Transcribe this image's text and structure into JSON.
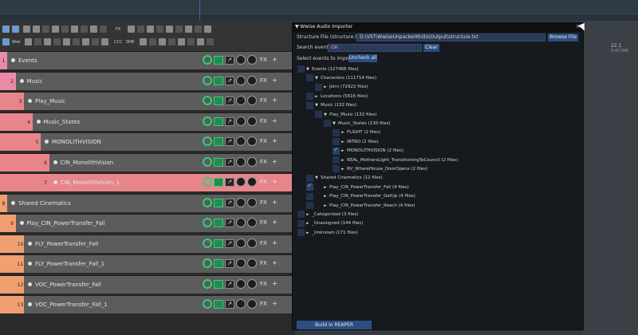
{
  "toolbar_labels": {
    "fx": "FX",
    "wwi": "Wwi",
    "ccc": "CCC",
    "shr": "SHR"
  },
  "tracks": [
    {
      "num": "1",
      "name": "Events",
      "depth": 0,
      "color": "#e88aa8",
      "selected": false
    },
    {
      "num": "2",
      "name": "Music",
      "depth": 1,
      "color": "#e88aa8",
      "selected": false
    },
    {
      "num": "3",
      "name": "Play_Music",
      "depth": 2,
      "color": "#e8858a",
      "selected": false
    },
    {
      "num": "4",
      "name": "Music_States",
      "depth": 3,
      "color": "#e8858a",
      "selected": false
    },
    {
      "num": "5",
      "name": "MONOLITHVISION",
      "depth": 4,
      "color": "#e8858a",
      "selected": false
    },
    {
      "num": "6",
      "name": "CIN_MonolithVision",
      "depth": 5,
      "color": "#e8858a",
      "selected": false
    },
    {
      "num": "7",
      "name": "CIN_MonolithVision_1",
      "depth": 5,
      "color": "#e8858a",
      "selected": true
    },
    {
      "num": "8",
      "name": "Shared Cinematics",
      "depth": 0,
      "color": "#f0a070",
      "selected": false
    },
    {
      "num": "9",
      "name": "Play_CIN_PowerTransfer_Fall",
      "depth": 1,
      "color": "#f0a070",
      "selected": false
    },
    {
      "num": "10",
      "name": "FLY_PowerTransfer_Fall",
      "depth": 2,
      "color": "#f0a070",
      "selected": false
    },
    {
      "num": "11",
      "name": "FLY_PowerTransfer_Fall_1",
      "depth": 2,
      "color": "#f0a070",
      "selected": false
    },
    {
      "num": "12",
      "name": "VOC_PowerTransfer_Fall",
      "depth": 2,
      "color": "#f0a070",
      "selected": false
    },
    {
      "num": "13",
      "name": "VOC_PowerTransfer_Fall_1",
      "depth": 2,
      "color": "#f0a070",
      "selected": false
    }
  ],
  "track_controls": {
    "fx": "FX",
    "plus": "+",
    "env": "↗"
  },
  "dialog": {
    "title": "Wwise Audio Importer",
    "collapse_glyph": "▼",
    "close_glyph": "×",
    "structure_label": "Structure File (structure.txt)",
    "structure_value": "D:\\VST\\WwiseUnpackerKhillo\\Output\\structure.txt",
    "browse_label": "Browse File",
    "search_label": "Search event:",
    "search_value": "cin",
    "clear_label": "Clear",
    "select_label": "Select events to import:",
    "uncheck_label": "Uncheck all",
    "build_label": "Build in REAPER",
    "tree": [
      {
        "label": "Events (127468 files)",
        "depth": 0,
        "arrow": "▼",
        "checked": false,
        "cb_depth": 0
      },
      {
        "label": "Characters (111714 files)",
        "depth": 1,
        "arrow": "▼",
        "checked": false,
        "cb_depth": 1
      },
      {
        "label": "John (72922 files)",
        "depth": 2,
        "arrow": "►",
        "checked": false,
        "cb_depth": 2
      },
      {
        "label": "Locations (5616 files)",
        "depth": 1,
        "arrow": "►",
        "checked": false,
        "cb_depth": 1
      },
      {
        "label": "Music (132 files)",
        "depth": 1,
        "arrow": "▼",
        "checked": false,
        "cb_depth": 1
      },
      {
        "label": "Play_Music (132 files)",
        "depth": 2,
        "arrow": "▼",
        "checked": false,
        "cb_depth": 2
      },
      {
        "label": "Music_States (130 files)",
        "depth": 3,
        "arrow": "▼",
        "checked": false,
        "cb_depth": 3
      },
      {
        "label": "FLIGHT (2 files)",
        "depth": 4,
        "arrow": "►",
        "checked": false,
        "cb_depth": 4
      },
      {
        "label": "INTRO (2 files)",
        "depth": 4,
        "arrow": "►",
        "checked": false,
        "cb_depth": 4
      },
      {
        "label": "MONOLITHVISION (2 files)",
        "depth": 4,
        "arrow": "►",
        "checked": true,
        "cb_depth": 4
      },
      {
        "label": "REAL_MothersLight_TransitioningToCouncil (2 files)",
        "depth": 4,
        "arrow": "►",
        "checked": false,
        "cb_depth": 4
      },
      {
        "label": "RV_WhareHouse_DoorOpens (2 files)",
        "depth": 4,
        "arrow": "►",
        "checked": false,
        "cb_depth": 4
      },
      {
        "label": "Shared Cinematics (12 files)",
        "depth": 1,
        "arrow": "▼",
        "checked": false,
        "cb_depth": 1
      },
      {
        "label": "Play_CIN_PowerTransfer_Fall (4 files)",
        "depth": 2,
        "arrow": "►",
        "checked": true,
        "cb_depth": 1
      },
      {
        "label": "Play_CIN_PowerTransfer_GetUp (4 files)",
        "depth": 2,
        "arrow": "►",
        "checked": false,
        "cb_depth": 1
      },
      {
        "label": "Play_CIN_PowerTransfer_Reach (4 files)",
        "depth": 2,
        "arrow": "►",
        "checked": false,
        "cb_depth": 1
      },
      {
        "label": "_Categorized (3 files)",
        "depth": 0,
        "arrow": "►",
        "checked": false,
        "cb_depth": 0
      },
      {
        "label": "_Unassigned (144 files)",
        "depth": 0,
        "arrow": "►",
        "checked": false,
        "cb_depth": 0
      },
      {
        "label": "_Unknown (171 files)",
        "depth": 0,
        "arrow": "►",
        "checked": false,
        "cb_depth": 0
      }
    ]
  },
  "timeline": {
    "marker_a": "22.1",
    "marker_b": "0:42.666"
  },
  "colors": {
    "accent": "#2c4f82",
    "track_green": "#2ed17a",
    "selected_track": "#e8858a"
  }
}
